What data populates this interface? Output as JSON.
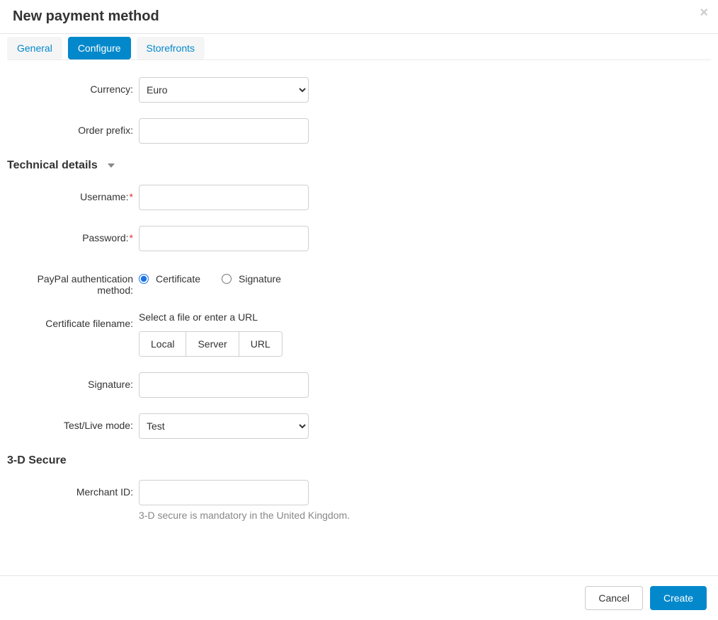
{
  "modal": {
    "title": "New payment method",
    "close_glyph": "×"
  },
  "tabs": {
    "general": "General",
    "configure": "Configure",
    "storefronts": "Storefronts"
  },
  "labels": {
    "currency": "Currency:",
    "order_prefix": "Order prefix:",
    "username": "Username:",
    "password": "Password:",
    "paypal_auth": "PayPal authentication method:",
    "cert_filename": "Certificate filename:",
    "signature": "Signature:",
    "test_live": "Test/Live mode:",
    "merchant_id": "Merchant ID:"
  },
  "sections": {
    "technical_details": "Technical details",
    "three_d_secure": "3-D Secure"
  },
  "values": {
    "currency_selected": "Euro",
    "order_prefix": "",
    "username": "",
    "password": "",
    "auth_method": "certificate",
    "signature": "",
    "test_live_selected": "Test",
    "merchant_id": ""
  },
  "radios": {
    "certificate": "Certificate",
    "signature": "Signature"
  },
  "file_picker": {
    "prompt": "Select a file or enter a URL",
    "local": "Local",
    "server": "Server",
    "url": "URL"
  },
  "hints": {
    "three_d_secure": "3-D secure is mandatory in the United Kingdom."
  },
  "footer": {
    "cancel": "Cancel",
    "create": "Create"
  },
  "options": {
    "currency": [
      "Euro"
    ],
    "test_live": [
      "Test"
    ]
  }
}
